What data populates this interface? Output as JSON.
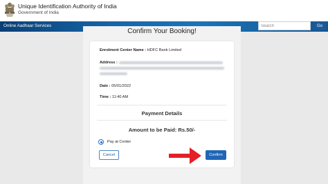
{
  "header": {
    "org_name": "Unique Identification Authority of India",
    "org_sub": "Government of India",
    "emblem": "national-emblem-icon"
  },
  "navbar": {
    "title": "Online Aadhaar Services",
    "search_placeholder": "Search",
    "go_label": "Go"
  },
  "page": {
    "title": "Confirm Your Booking!"
  },
  "booking": {
    "center_label": "Enrolment Center Name :",
    "center_value": "HDFC Bank Limited",
    "address_label": "Address :",
    "date_label": "Date :",
    "date_value": "05/01/2022",
    "time_label": "Time :",
    "time_value": "11:40 AM"
  },
  "payment": {
    "heading": "Payment Details",
    "amount_text": "Amount to be Paid: Rs.50/-",
    "option_label": "Pay at Center",
    "option_selected": true
  },
  "actions": {
    "cancel_label": "Cancel",
    "confirm_label": "Confirm"
  },
  "colors": {
    "nav_blue": "#1766a8",
    "button_blue": "#1f66b6",
    "annotation_arrow": "#e41f26"
  },
  "annotation": {
    "arrow_icon": "red-arrow-icon"
  }
}
